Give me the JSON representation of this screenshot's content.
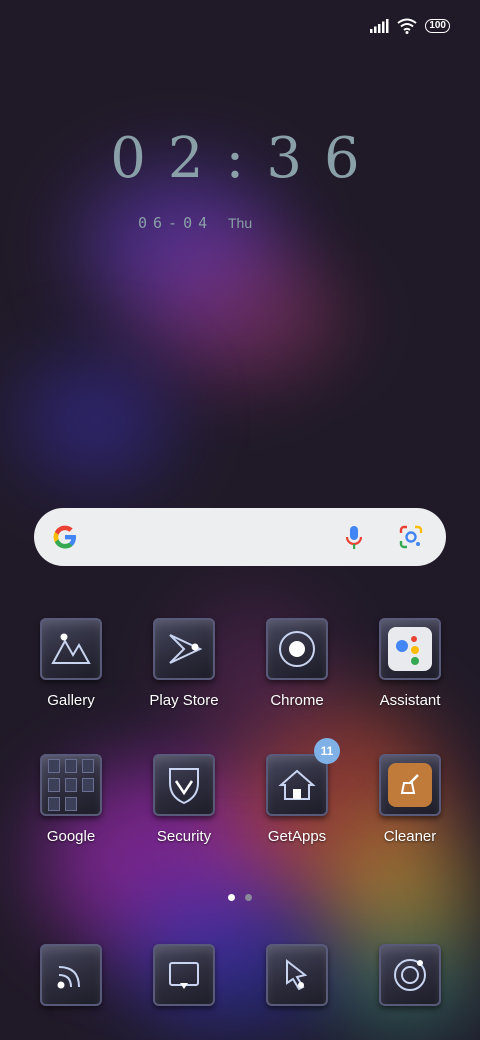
{
  "status_bar": {
    "battery": "100",
    "icons": [
      "signal-icon",
      "wifi-icon",
      "battery-icon"
    ]
  },
  "clock": {
    "time": "02:36",
    "date": "06-04",
    "day": "Thu"
  },
  "search_bar": {
    "icons": [
      "google-logo-icon",
      "mic-icon",
      "lens-icon"
    ]
  },
  "apps_row1": [
    {
      "label": "Gallery"
    },
    {
      "label": "Play Store"
    },
    {
      "label": "Chrome"
    },
    {
      "label": "Assistant"
    }
  ],
  "apps_row2": [
    {
      "label": "Google"
    },
    {
      "label": "Security"
    },
    {
      "label": "GetApps",
      "badge": "11"
    },
    {
      "label": "Cleaner"
    }
  ],
  "dock": {
    "icons": [
      "rss-dock-icon",
      "tv-dock-icon",
      "cursor-dock-icon",
      "camera-dock-icon"
    ]
  },
  "page_indicator": {
    "pages": 2,
    "active": 1
  }
}
